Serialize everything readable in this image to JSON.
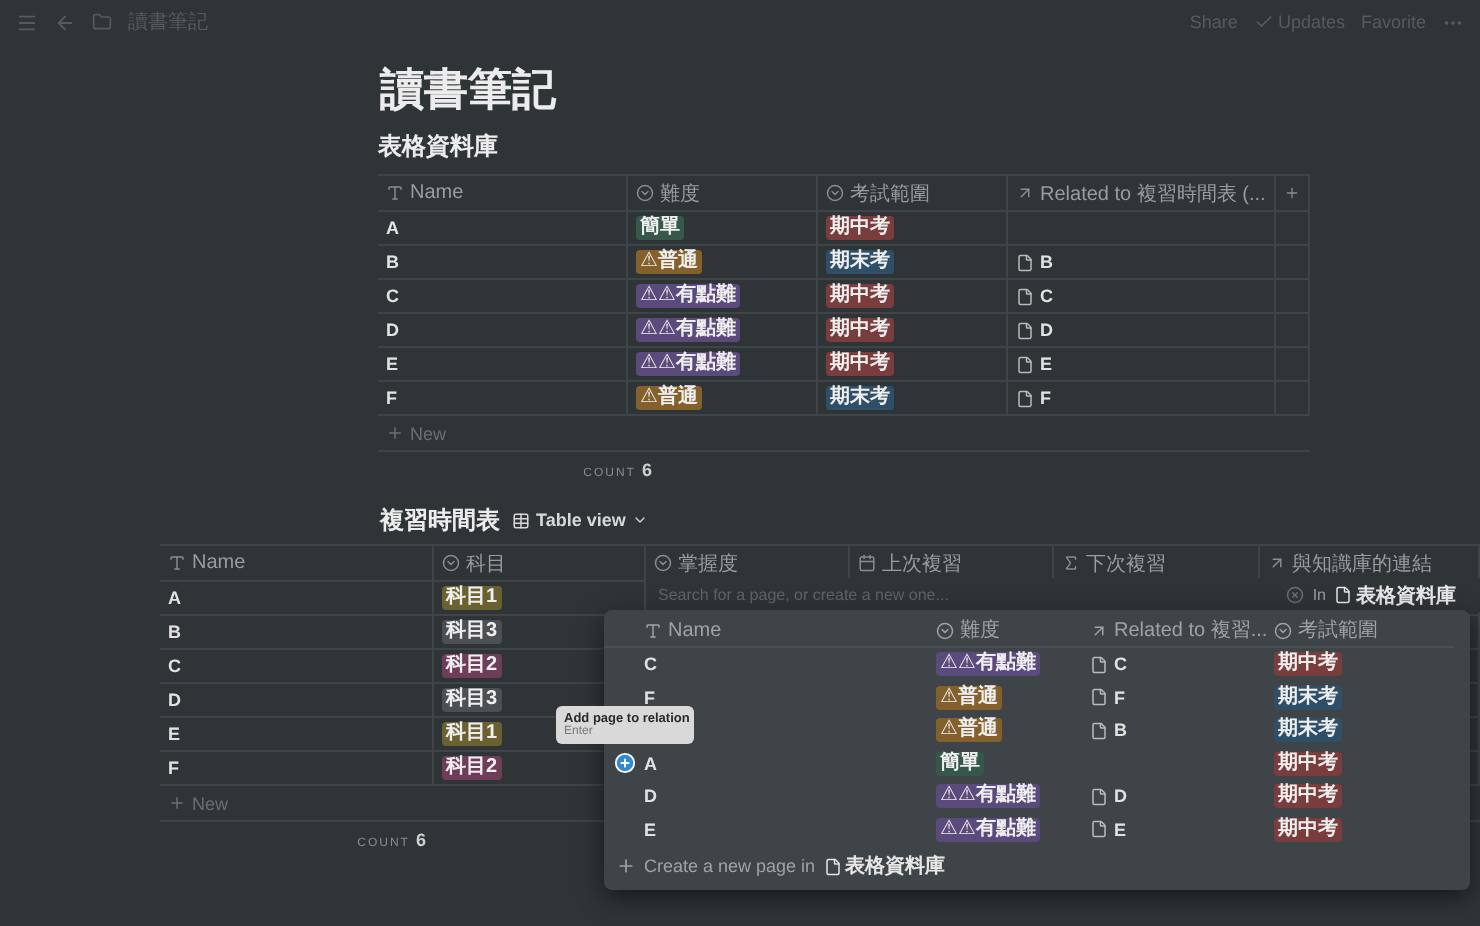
{
  "topbar": {
    "breadcrumb": "讀書筆記",
    "actions": [
      {
        "label": "Share",
        "kind": "text"
      },
      {
        "label": "Updates",
        "kind": "check"
      },
      {
        "label": "Favorite",
        "kind": "text"
      }
    ]
  },
  "title": "讀書筆記",
  "database1": {
    "title": "表格資料庫",
    "columns": [
      {
        "label": "Name",
        "kind": "text"
      },
      {
        "label": "難度",
        "kind": "select"
      },
      {
        "label": "考試範圍",
        "kind": "select"
      },
      {
        "label": "Related to 複習時間表 (...",
        "kind": "relation"
      },
      {
        "kind": "add"
      }
    ],
    "rows": [
      {
        "name": "A",
        "difficulty": {
          "label": "簡單",
          "color": "#35584a"
        },
        "exam": {
          "label": "期中考",
          "color": "#7a3d3d"
        }
      },
      {
        "name": "B",
        "difficulty": {
          "label": "⚠普通",
          "color": "#84612c"
        },
        "exam": {
          "label": "期末考",
          "color": "#2f4f69"
        },
        "related": "B"
      },
      {
        "name": "C",
        "difficulty": {
          "label": "⚠⚠有點難",
          "color": "#5b4a7c"
        },
        "exam": {
          "label": "期中考",
          "color": "#7a3d3d"
        },
        "related": "C"
      },
      {
        "name": "D",
        "difficulty": {
          "label": "⚠⚠有點難",
          "color": "#5b4a7c"
        },
        "exam": {
          "label": "期中考",
          "color": "#7a3d3d"
        },
        "related": "D"
      },
      {
        "name": "E",
        "difficulty": {
          "label": "⚠⚠有點難",
          "color": "#5b4a7c"
        },
        "exam": {
          "label": "期中考",
          "color": "#7a3d3d"
        },
        "related": "E"
      },
      {
        "name": "F",
        "difficulty": {
          "label": "⚠普通",
          "color": "#84612c"
        },
        "exam": {
          "label": "期末考",
          "color": "#2f4f69"
        },
        "related": "F"
      }
    ],
    "new_label": "New",
    "count_label": "COUNT",
    "count": "6"
  },
  "database2": {
    "title": "複習時間表",
    "view": "Table view",
    "columns": [
      {
        "label": "Name",
        "kind": "text"
      },
      {
        "label": "科目",
        "kind": "select"
      },
      {
        "label": "掌握度",
        "kind": "select"
      },
      {
        "label": "上次複習",
        "kind": "date"
      },
      {
        "label": "下次複習",
        "kind": "formula"
      },
      {
        "label": "與知識庫的連結",
        "kind": "relation"
      }
    ],
    "rows": [
      {
        "name": "A",
        "subject": {
          "label": "科目1",
          "color": "#6b6030"
        }
      },
      {
        "name": "B",
        "subject": {
          "label": "科目3",
          "color": "#4c5052"
        }
      },
      {
        "name": "C",
        "subject": {
          "label": "科目2",
          "color": "#6e3d5a"
        }
      },
      {
        "name": "D",
        "subject": {
          "label": "科目3",
          "color": "#4c5052"
        }
      },
      {
        "name": "E",
        "subject": {
          "label": "科目1",
          "color": "#6b6030"
        }
      },
      {
        "name": "F",
        "subject": {
          "label": "科目2",
          "color": "#6e3d5a"
        }
      }
    ],
    "new_label": "New",
    "count_label": "COUNT",
    "count": "6"
  },
  "relation_popup": {
    "search_placeholder": "Search for a page, or create a new one...",
    "scope_label": "In",
    "scope_db": "表格資料庫",
    "columns": [
      {
        "label": "Name",
        "kind": "text"
      },
      {
        "label": "難度",
        "kind": "select"
      },
      {
        "label": "Related to 複習...",
        "kind": "relation"
      },
      {
        "label": "考試範圍",
        "kind": "select"
      }
    ],
    "rows": [
      {
        "name": "C",
        "hovered": false,
        "difficulty": {
          "label": "⚠⚠有點難",
          "color": "#5b4a7c"
        },
        "related": "C",
        "exam": {
          "label": "期中考",
          "color": "#7a3d3d"
        }
      },
      {
        "name": "F",
        "hovered": false,
        "difficulty": {
          "label": "⚠普通",
          "color": "#84612c"
        },
        "related": "F",
        "exam": {
          "label": "期末考",
          "color": "#2f4f69"
        }
      },
      {
        "hovered": false,
        "difficulty": {
          "label": "⚠普通",
          "color": "#84612c"
        },
        "related": "B",
        "exam": {
          "label": "期末考",
          "color": "#2f4f69"
        }
      },
      {
        "name": "A",
        "hovered": true,
        "difficulty": {
          "label": "簡單",
          "color": "#35584a"
        },
        "exam": {
          "label": "期中考",
          "color": "#7a3d3d"
        }
      },
      {
        "name": "D",
        "hovered": false,
        "difficulty": {
          "label": "⚠⚠有點難",
          "color": "#5b4a7c"
        },
        "related": "D",
        "exam": {
          "label": "期中考",
          "color": "#7a3d3d"
        }
      },
      {
        "name": "E",
        "hovered": false,
        "difficulty": {
          "label": "⚠⚠有點難",
          "color": "#5b4a7c"
        },
        "related": "E",
        "exam": {
          "label": "期中考",
          "color": "#7a3d3d"
        }
      }
    ],
    "create_label": "Create a new page in",
    "create_db": "表格資料庫"
  },
  "tooltip": {
    "title": "Add page to relation",
    "hint": "Enter"
  }
}
